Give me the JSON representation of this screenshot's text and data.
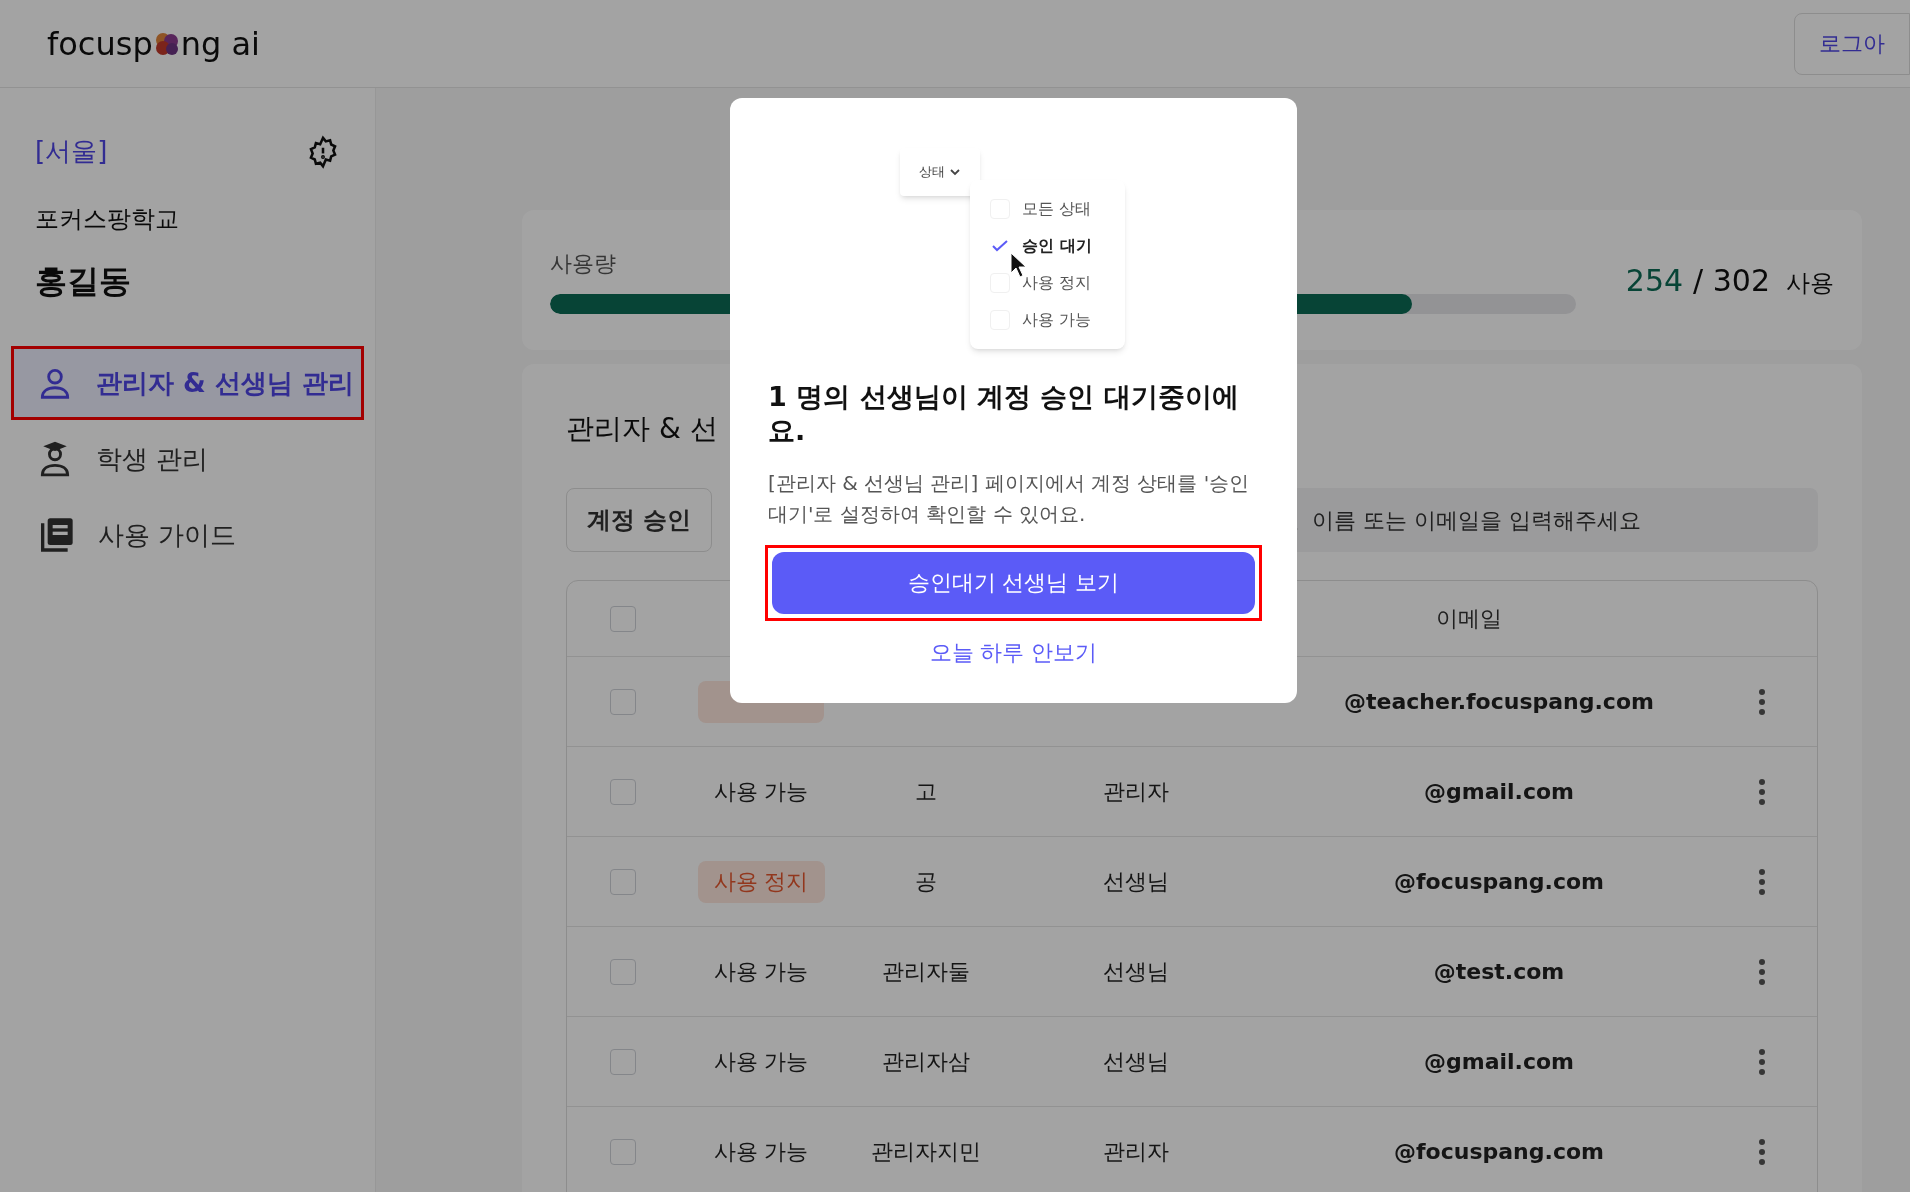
{
  "header": {
    "logo_start": "focusp",
    "logo_end": "ng ai",
    "logout_button": "로그아"
  },
  "sidebar": {
    "region": "[서울]",
    "school": "포커스팡학교",
    "user": "홍길동",
    "items": [
      {
        "label": "관리자 & 선생님 관리",
        "kind": "person",
        "selected": true,
        "annotated": true
      },
      {
        "label": "학생 관리",
        "kind": "student",
        "selected": false,
        "annotated": false
      },
      {
        "label": "사용 가이드",
        "kind": "guide",
        "selected": false,
        "annotated": false
      }
    ]
  },
  "usage": {
    "label": "사용량",
    "level": 0.84,
    "used": "254",
    "total": "/ 302",
    "unit": "사용"
  },
  "panel": {
    "title": "관리자 & 선",
    "approve_button": "계정 승인",
    "search": {
      "placeholder": "이름 또는 이메일을 입력해주세요"
    },
    "table": {
      "header_checked": false,
      "columns": [
        "이메일"
      ],
      "rows": [
        {
          "checked": false,
          "kind": "badge",
          "email": "@teacher.focuspang.com"
        },
        {
          "checked": false,
          "status": "사용 가능",
          "kind": "plain",
          "name": "고",
          "role": "관리자",
          "email": "@gmail.com"
        },
        {
          "checked": false,
          "status": "사용 정지",
          "kind": "badge",
          "name": "공",
          "role": "선생님",
          "email": "@focuspang.com"
        },
        {
          "checked": false,
          "status": "사용 가능",
          "kind": "plain",
          "name": "관리자둘",
          "role": "선생님",
          "email": "@test.com"
        },
        {
          "checked": false,
          "status": "사용 가능",
          "kind": "plain",
          "name": "관리자삼",
          "role": "선생님",
          "email": "@gmail.com"
        },
        {
          "checked": false,
          "status": "사용 가능",
          "kind": "plain",
          "name": "관리자지민",
          "role": "관리자",
          "email": "@focuspang.com"
        }
      ]
    }
  },
  "modal": {
    "dropdown_label": "상태",
    "options": [
      {
        "label": "모든 상태",
        "checked": false
      },
      {
        "label": "승인 대기",
        "checked": true
      },
      {
        "label": "사용 정지",
        "checked": false
      },
      {
        "label": "사용 가능",
        "checked": false
      }
    ],
    "title": "1 명의 선생님이 계정 승인 대기중이에요.",
    "description": "[관리자 & 선생님 관리] 페이지에서 계정 상태를 '승인 대기'로 설정하여 확인할 수 있어요.",
    "primary_button": "승인대기 선생님 보기",
    "primary_annotated": true,
    "dismiss_link": "오늘 하루 안보기"
  }
}
